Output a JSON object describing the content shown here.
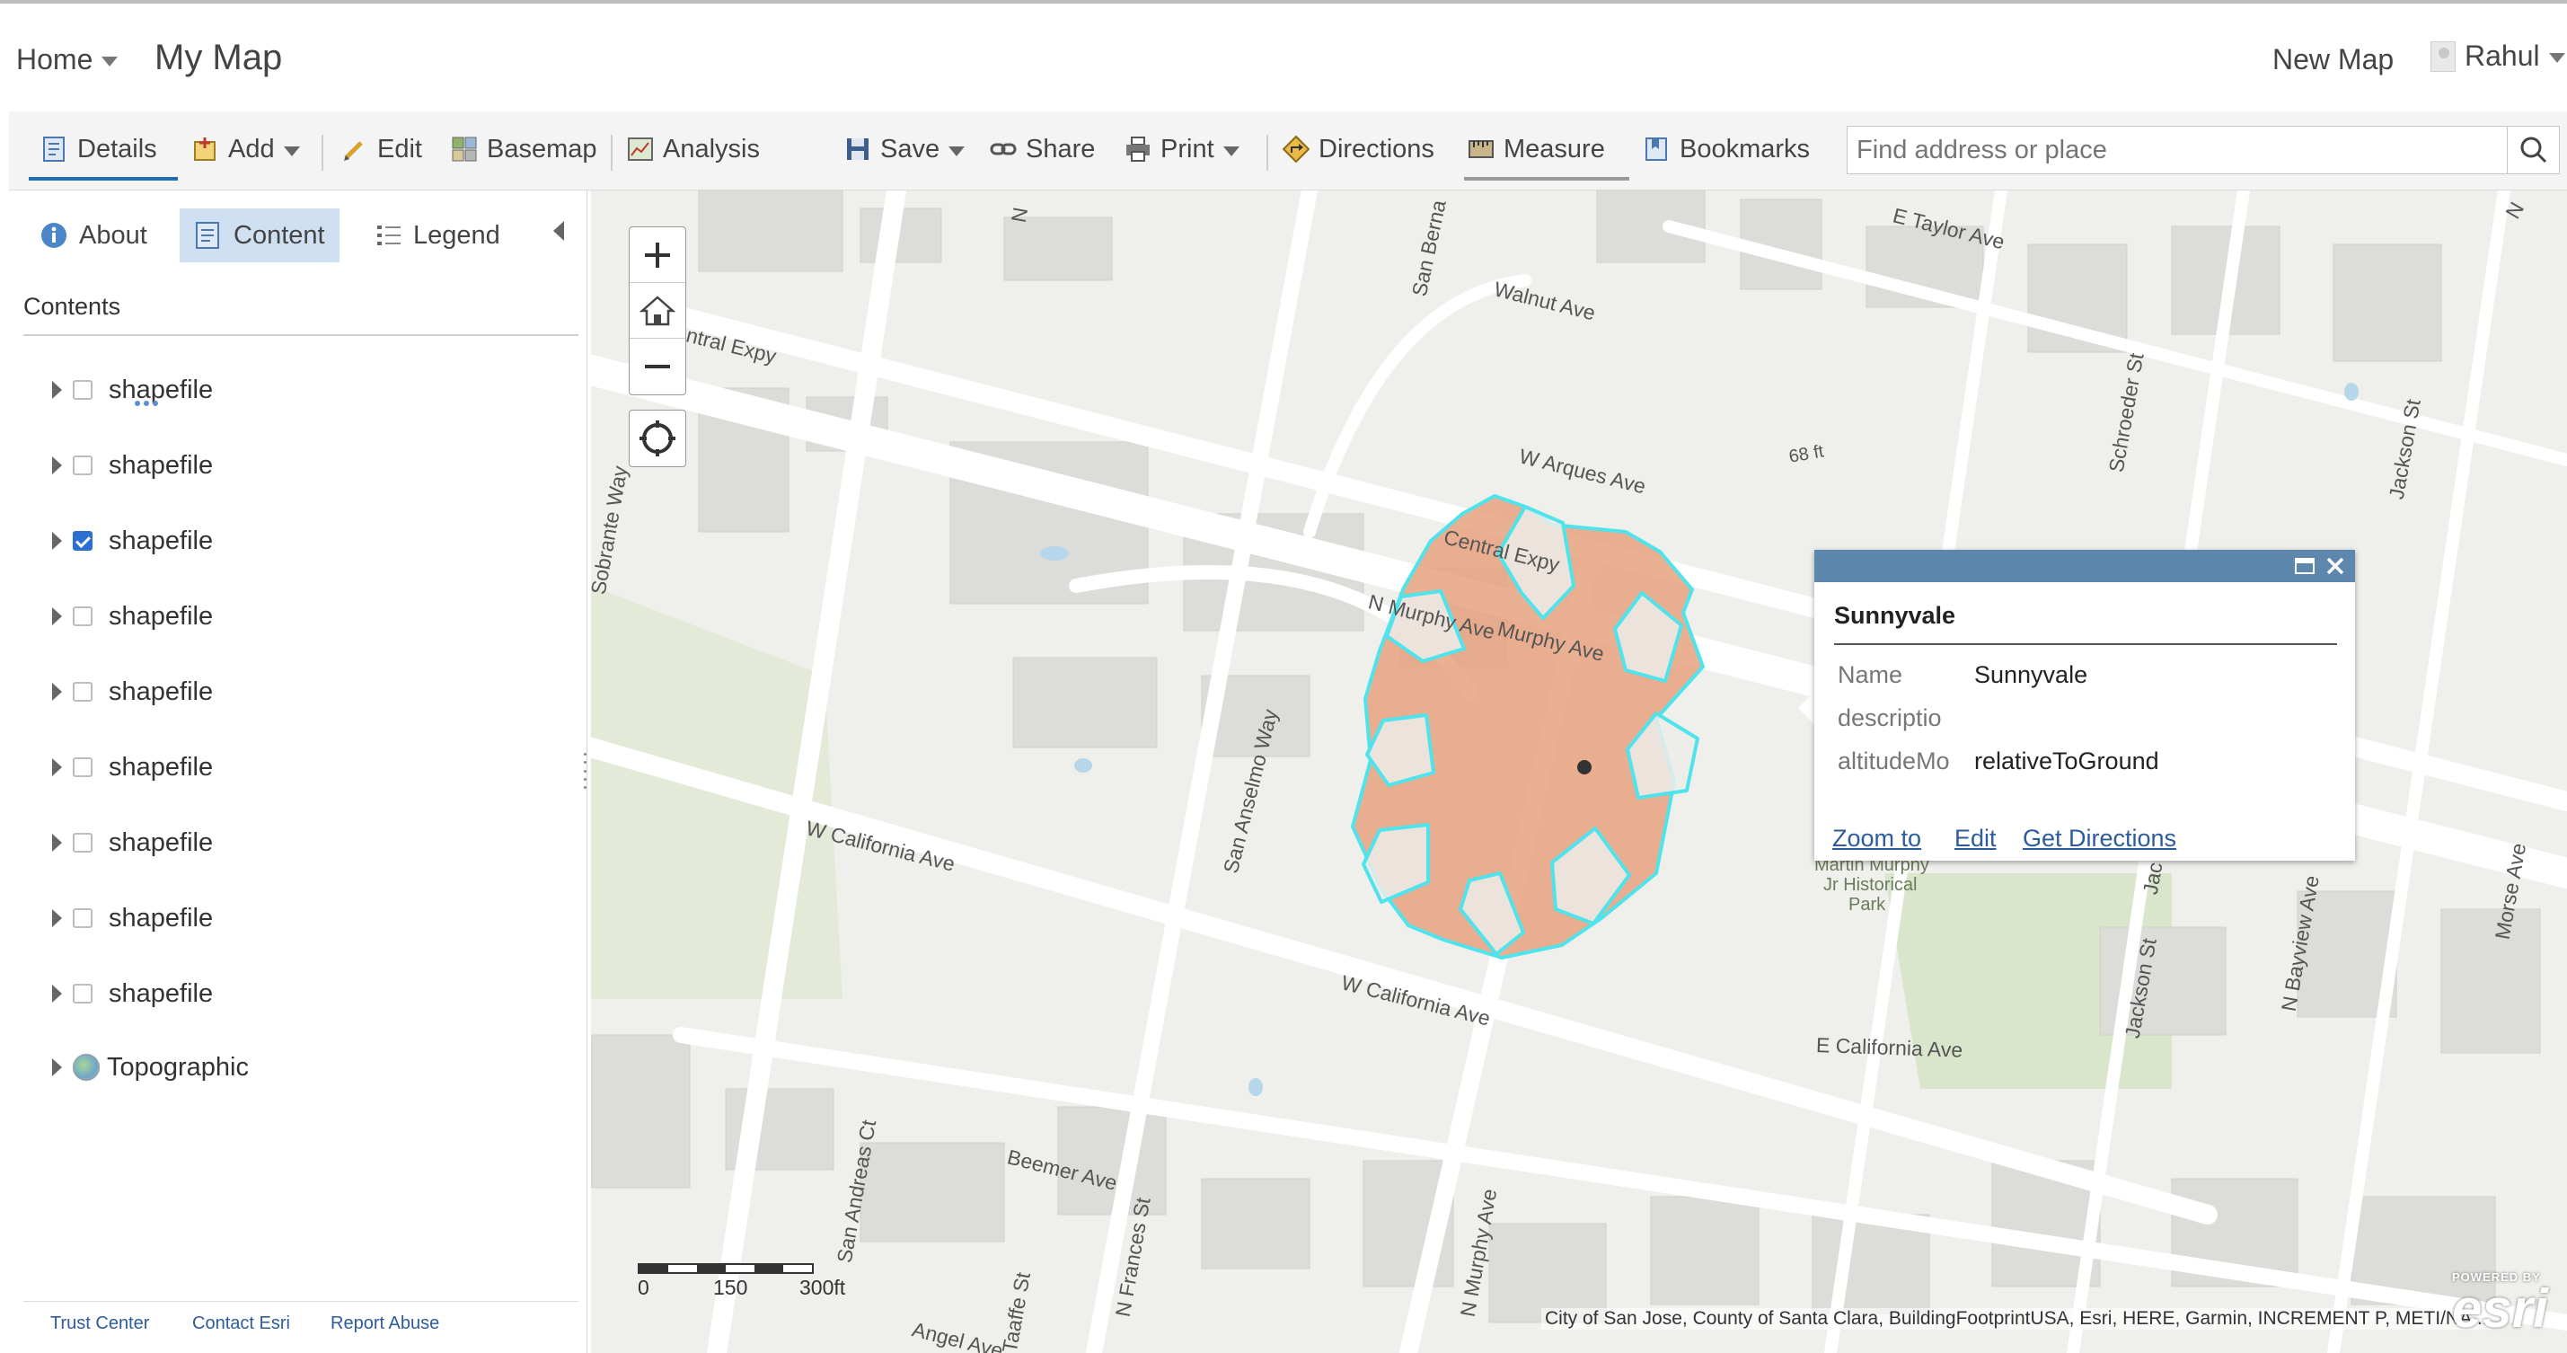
{
  "header": {
    "home_label": "Home",
    "map_title": "My Map",
    "new_map_label": "New Map",
    "user_name": "Rahul"
  },
  "toolbar": {
    "details": "Details",
    "add": "Add",
    "edit": "Edit",
    "basemap": "Basemap",
    "analysis": "Analysis",
    "save": "Save",
    "share": "Share",
    "print": "Print",
    "directions": "Directions",
    "measure": "Measure",
    "bookmarks": "Bookmarks",
    "search_placeholder": "Find address or place"
  },
  "panel": {
    "tabs": {
      "about": "About",
      "content": "Content",
      "legend": "Legend"
    },
    "contents_heading": "Contents",
    "layers": [
      {
        "name": "shapefile",
        "checked": false
      },
      {
        "name": "shapefile",
        "checked": false
      },
      {
        "name": "shapefile",
        "checked": true
      },
      {
        "name": "shapefile",
        "checked": false
      },
      {
        "name": "shapefile",
        "checked": false
      },
      {
        "name": "shapefile",
        "checked": false
      },
      {
        "name": "shapefile",
        "checked": false
      },
      {
        "name": "shapefile",
        "checked": false
      },
      {
        "name": "shapefile",
        "checked": false
      },
      {
        "name": "Topographic",
        "checked": null
      }
    ],
    "footer": {
      "trust": "Trust Center",
      "contact": "Contact Esri",
      "report": "Report Abuse"
    }
  },
  "popup": {
    "title": "Sunnyvale",
    "rows": [
      {
        "key": "Name",
        "value": "Sunnyvale"
      },
      {
        "key": "descriptio",
        "value": ""
      },
      {
        "key": "altitudeMo",
        "value": "relativeToGround"
      }
    ],
    "links": {
      "zoom": "Zoom to",
      "edit": "Edit",
      "directions": "Get Directions"
    }
  },
  "map": {
    "streets": [
      "Central Expy",
      "Walnut Ave",
      "W Arques Ave",
      "E Taylor Ave",
      "Central Expy",
      "N Murphy Ave",
      "Murphy Ave",
      "W California Ave",
      "W California Ave",
      "E California Ave",
      "San Anselmo Way",
      "Sobrante Way",
      "Beemer Ave",
      "San Andreas Ct",
      "N Frances St",
      "Taaffe St",
      "N Murphy Ave",
      "Angel Ave",
      "Schroeder St",
      "Jackson St",
      "Jackson St",
      "N Bayview Ave",
      "Morse Ave",
      "San Berna",
      "N",
      "N",
      "Jac"
    ],
    "elevation_label": "68 ft",
    "park_label": [
      "Martin Murphy",
      "Jr Historical",
      "Park"
    ],
    "scale": {
      "zero": "0",
      "mid": "150",
      "end": "300ft"
    },
    "attribution": "City of San Jose, County of Santa Clara, BuildingFootprintUSA, Esri, HERE, Garmin, INCREMENT P, METI/NA...",
    "logo_top": "POWERED BY",
    "logo": "esri",
    "colors": {
      "polygon_fill": "#e6a27f",
      "polygon_stroke": "#4fe3ec",
      "popup_header": "#5d87ad",
      "link": "#2d5c9e"
    }
  },
  "icons": [
    "details-icon",
    "add-icon",
    "edit-icon",
    "basemap-icon",
    "analysis-icon",
    "save-icon",
    "share-icon",
    "print-icon",
    "directions-icon",
    "measure-icon",
    "bookmarks-icon",
    "search-icon",
    "info-icon",
    "content-icon",
    "legend-icon",
    "zoom-in-icon",
    "home-icon",
    "zoom-out-icon",
    "locate-icon",
    "maximize-icon",
    "close-icon"
  ]
}
